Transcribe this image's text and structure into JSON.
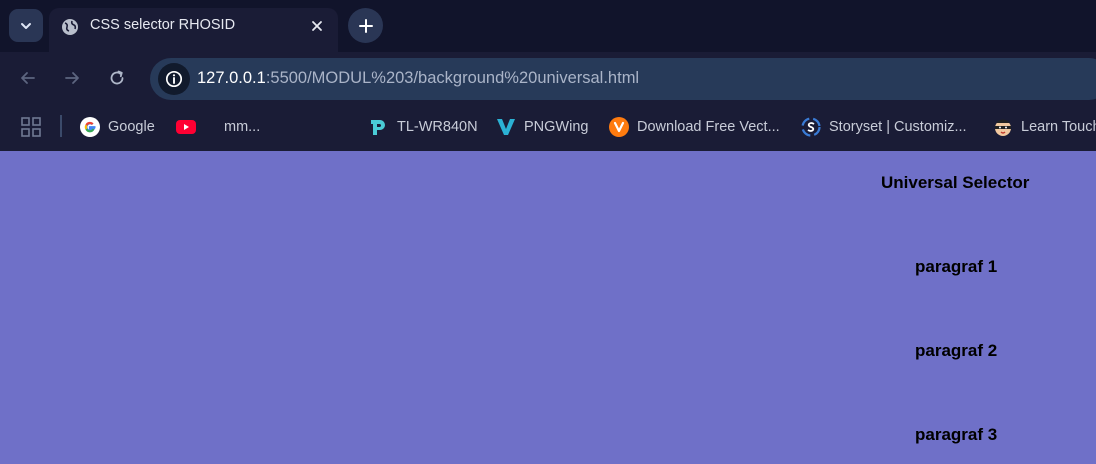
{
  "tab": {
    "title": "CSS selector RHOSID"
  },
  "address": {
    "host": "127.0.0.1",
    "path": ":5500/MODUL%203/background%20universal.html"
  },
  "bookmarks": [
    {
      "label": "Google",
      "icon": "google-icon"
    },
    {
      "label": "",
      "icon": "youtube-icon"
    },
    {
      "label": "mm...",
      "icon": ""
    },
    {
      "label": "TL-WR840N",
      "icon": "tplink-icon"
    },
    {
      "label": "PNGWing",
      "icon": "pngwing-icon"
    },
    {
      "label": "Download Free Vect...",
      "icon": "vecteezy-icon"
    },
    {
      "label": "Storyset | Customiz...",
      "icon": "storyset-icon"
    },
    {
      "label": "Learn Touch",
      "icon": "ninja-icon"
    }
  ],
  "page": {
    "background": "#6f70c8",
    "heading": "Universal Selector",
    "paragraphs": [
      "paragraf 1",
      "paragraf 2",
      "paragraf 3"
    ]
  }
}
